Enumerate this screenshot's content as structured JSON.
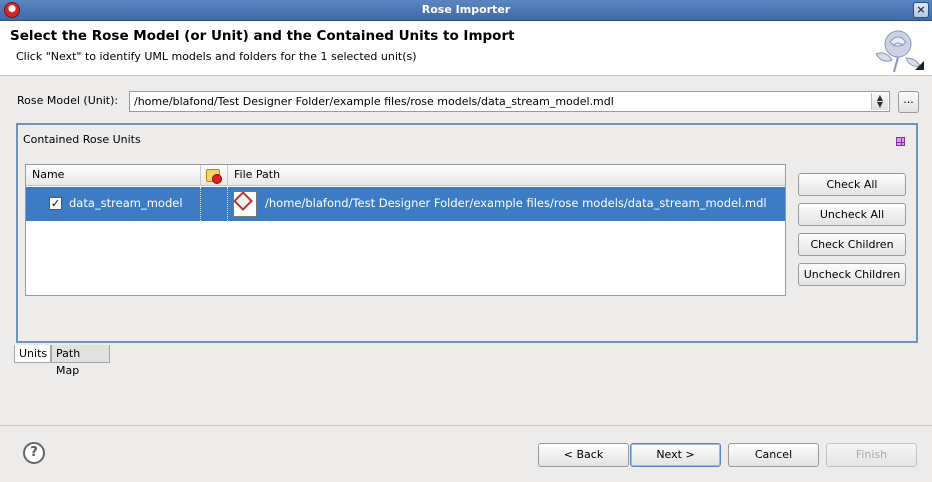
{
  "window": {
    "title": "Rose Importer",
    "close_glyph": "×",
    "app_icon": "rose-app-icon"
  },
  "header": {
    "title": "Select the Rose Model (or Unit) and the Contained Units to Import",
    "subtitle": "Click \"Next\" to identify UML models and folders for the 1 selected unit(s)",
    "banner_icon": "rose-flower-icon"
  },
  "rose_model": {
    "label": "Rose Model (Unit):",
    "value": "/home/blafond/Test Designer Folder/example files/rose models/data_stream_model.mdl",
    "browse_label": "..."
  },
  "contained_units": {
    "title": "Contained Rose Units",
    "columns": [
      "Name",
      "",
      "File Path"
    ],
    "rows": [
      {
        "checked": true,
        "name": "data_stream_model",
        "path": "/home/blafond/Test Designer Folder/example files/rose models/data_stream_model.mdl"
      }
    ],
    "buttons": {
      "check_all": "Check All",
      "uncheck_all": "Uncheck All",
      "check_children": "Check Children",
      "uncheck_children": "Uncheck Children"
    }
  },
  "tabs": [
    {
      "label": "Units",
      "active": true
    },
    {
      "label": "Path Map",
      "active": false
    }
  ],
  "footer": {
    "help_glyph": "?",
    "back": "< Back",
    "next": "Next >",
    "cancel": "Cancel",
    "finish": "Finish"
  },
  "colors": {
    "title_bar": "#4a76b4",
    "selection": "#3d7cc5",
    "group_border": "#6d93c2"
  }
}
